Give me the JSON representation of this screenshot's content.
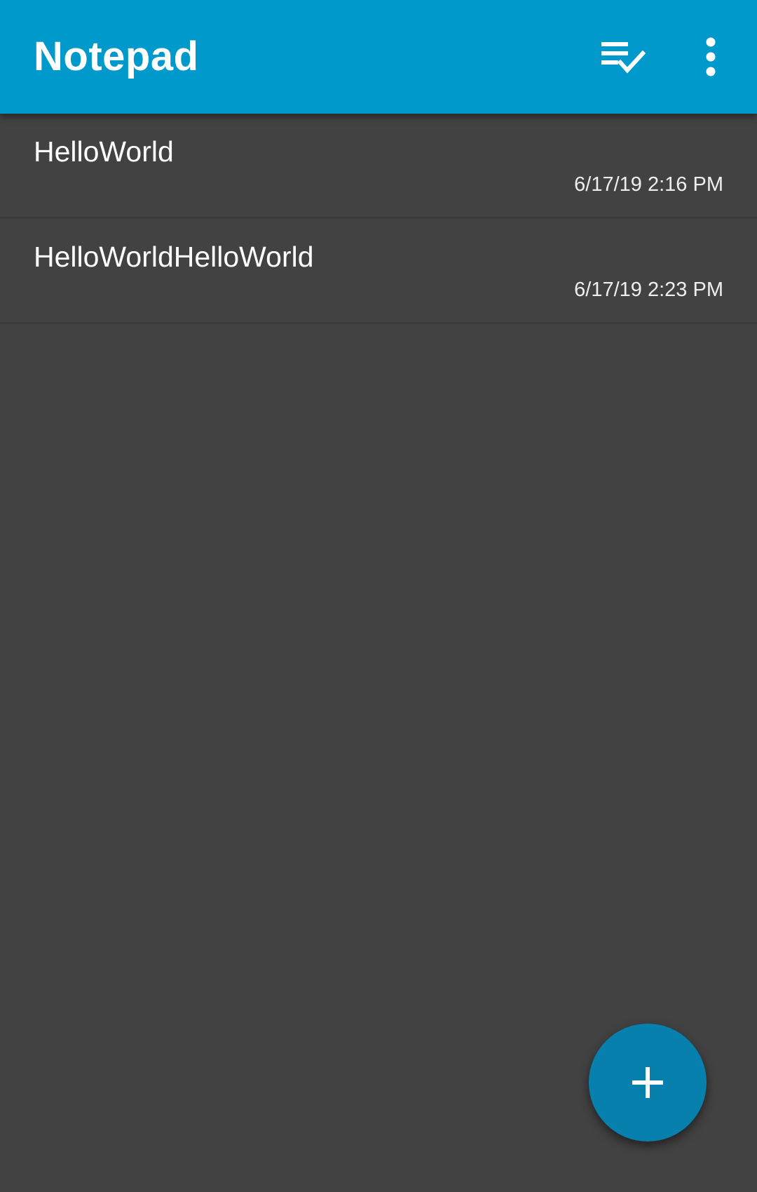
{
  "app": {
    "title": "Notepad"
  },
  "toolbar": {
    "select_icon": "playlist-check-icon",
    "more_icon": "more-vertical-icon"
  },
  "notes": [
    {
      "title": "HelloWorld",
      "date": "6/17/19 2:16 PM"
    },
    {
      "title": "HelloWorldHelloWorld",
      "date": "6/17/19 2:23 PM"
    }
  ],
  "fab": {
    "icon": "plus-icon"
  },
  "colors": {
    "appbar": "#0099CC",
    "background": "#424242",
    "fab": "#0780AE",
    "text": "#FFFFFF"
  }
}
